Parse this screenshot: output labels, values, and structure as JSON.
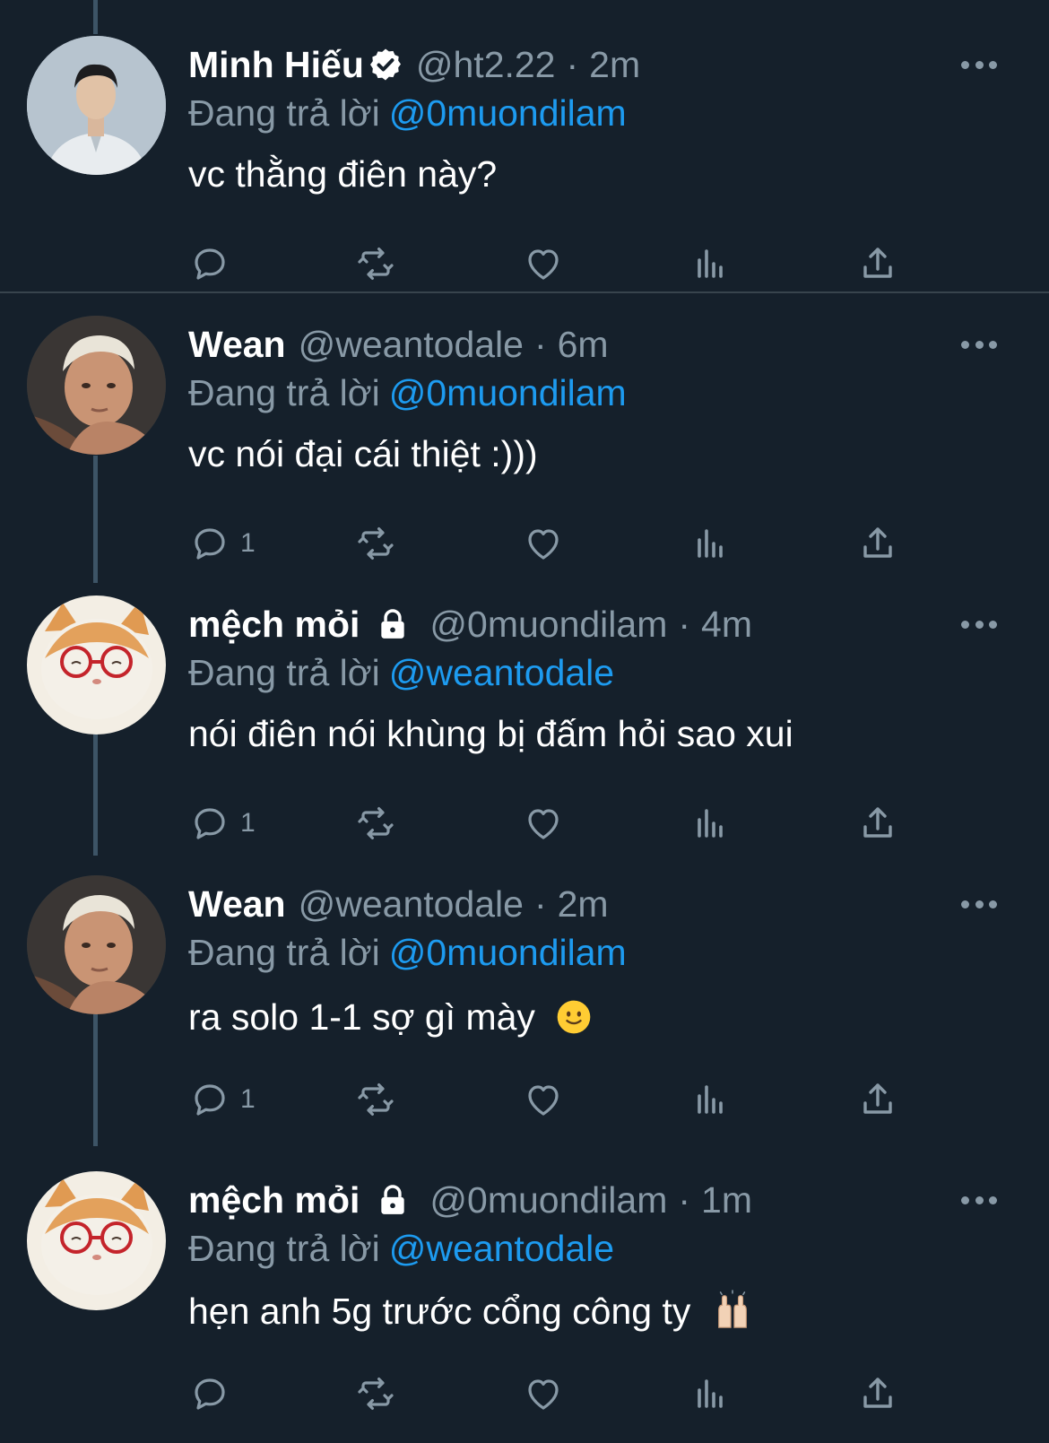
{
  "colors": {
    "background": "#15202b",
    "secondary_text": "#8899a6",
    "mention": "#1d9bf0",
    "thread_line": "#3d5466",
    "verified_badge": "#ffffff"
  },
  "reply_prefix": "Đang trả lời",
  "tweets": [
    {
      "name": "Minh Hiếu",
      "verified": true,
      "locked": false,
      "handle": "@ht2.22",
      "time": "2m",
      "reply_to": "@0muondilam",
      "text": "vc thằng điên này?",
      "reply_count": "",
      "avatar": "man-photo"
    },
    {
      "name": "Wean",
      "verified": false,
      "locked": false,
      "handle": "@weantodale",
      "time": "6m",
      "reply_to": "@0muondilam",
      "text": "vc nói đại cái thiệt :)))",
      "reply_count": "1",
      "avatar": "blond-man-photo"
    },
    {
      "name": "mệch mỏi",
      "verified": false,
      "locked": true,
      "handle": "@0muondilam",
      "time": "4m",
      "reply_to": "@weantodale",
      "text": "nói điên nói khùng bị đấm hỏi sao xui",
      "reply_count": "1",
      "avatar": "cat-with-glasses"
    },
    {
      "name": "Wean",
      "verified": false,
      "locked": false,
      "handle": "@weantodale",
      "time": "2m",
      "reply_to": "@0muondilam",
      "text": "ra solo 1-1 sợ gì mày",
      "emoji": "slightly-smiling-face",
      "reply_count": "1",
      "avatar": "blond-man-photo"
    },
    {
      "name": "mệch mỏi",
      "verified": false,
      "locked": true,
      "handle": "@0muondilam",
      "time": "1m",
      "reply_to": "@weantodale",
      "text": "hẹn anh 5g trước cổng công ty",
      "emoji": "raising-hands",
      "reply_count": "",
      "avatar": "cat-with-glasses"
    }
  ],
  "icons": {
    "more": "more-dots-icon",
    "reply": "reply-bubble-icon",
    "retweet": "retweet-icon",
    "like": "heart-icon",
    "views": "analytics-bars-icon",
    "share": "share-upload-icon"
  }
}
